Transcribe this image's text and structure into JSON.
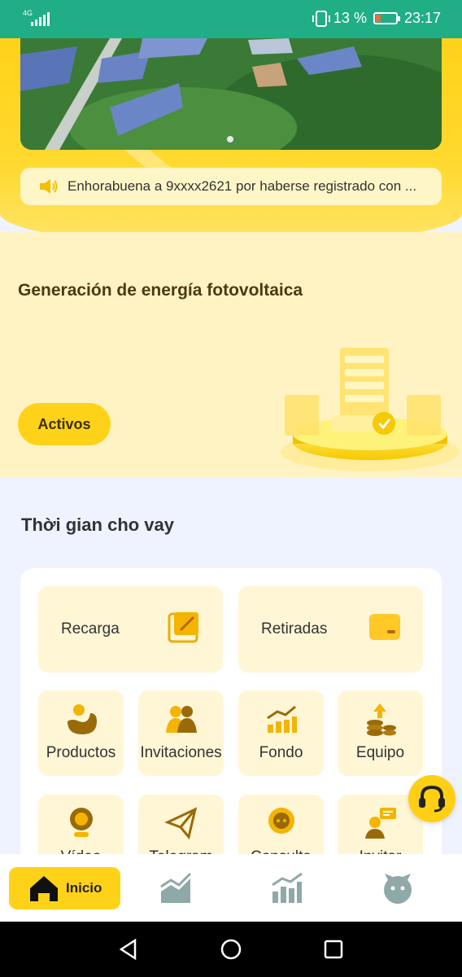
{
  "status_bar": {
    "network": "4G",
    "battery_percent": "13 %",
    "time": "23:17",
    "icons": [
      "signal-icon",
      "vibrate-icon",
      "battery-icon"
    ]
  },
  "notice": {
    "icon": "speaker-icon",
    "text": "Enhorabuena a 9xxxx2621 por haberse registrado con ..."
  },
  "banner": {
    "carousel_position": 1
  },
  "energy": {
    "title": "Generación de energía fotovoltaica",
    "button_label": "Activos"
  },
  "loan": {
    "title": "Thời gian cho vay",
    "big_actions": [
      {
        "label": "Recarga",
        "icon": "recharge-icon"
      },
      {
        "label": "Retiradas",
        "icon": "wallet-icon"
      }
    ],
    "grid_row1": [
      {
        "label": "Productos",
        "icon": "products-icon"
      },
      {
        "label": "Invitaciones",
        "icon": "people-icon"
      },
      {
        "label": "Fondo",
        "icon": "bar-chart-icon"
      },
      {
        "label": "Equipo",
        "icon": "coins-icon"
      }
    ],
    "grid_row2": [
      {
        "label": "Vídeo",
        "icon": "webcam-icon"
      },
      {
        "label": "Telegram",
        "icon": "telegram-icon"
      },
      {
        "label": "Consulta",
        "icon": "chat-icon"
      },
      {
        "label": "Invitar",
        "icon": "invite-icon"
      }
    ]
  },
  "tabbar": {
    "home_label": "Inicio",
    "tabs": [
      "home-icon",
      "trend-icon",
      "stats-icon",
      "profile-icon"
    ]
  },
  "colors": {
    "status_bar": "#1fae85",
    "accent": "#ffd21a",
    "card_bg": "#fff6d6",
    "icon_brown": "#9a6a08"
  }
}
